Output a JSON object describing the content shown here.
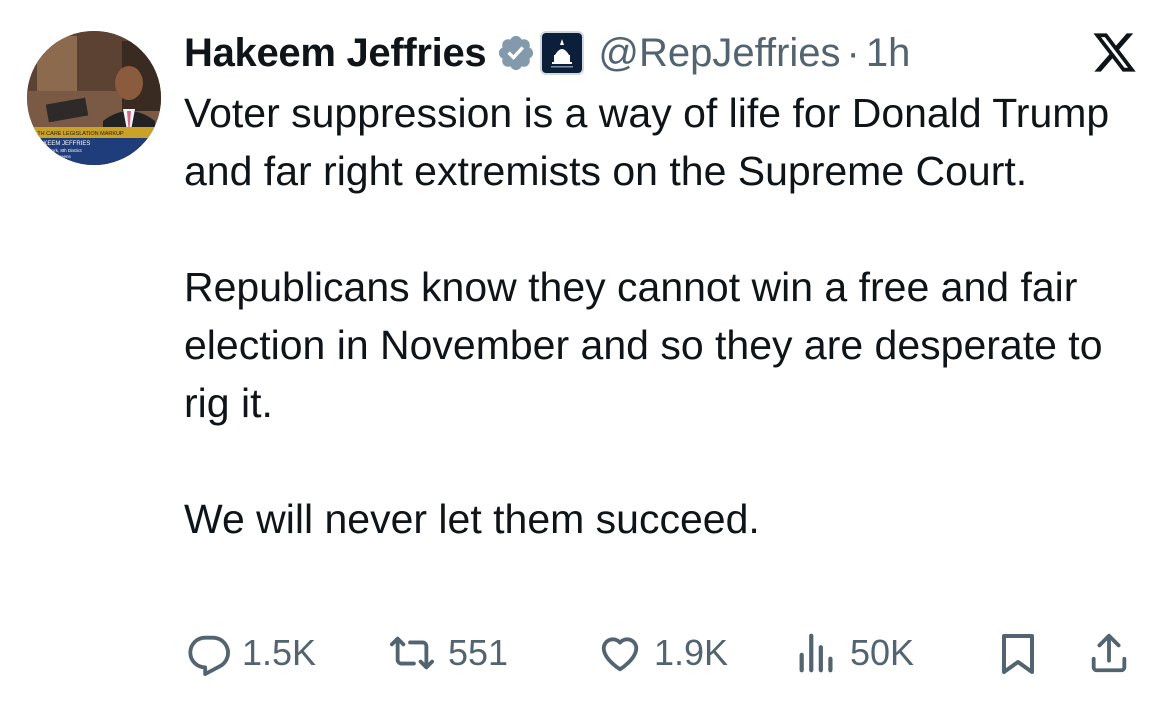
{
  "tweet": {
    "author_name": "Hakeem Jeffries",
    "handle": "@RepJeffries",
    "separator": "·",
    "time": "1h",
    "paragraphs": [
      "Voter suppression is a way of life for Donald Trump and far right extremists on the Supreme Court.",
      "Republicans know they cannot win a free and fair election in November and so they are desperate to rig it.",
      "We will never let them succeed."
    ],
    "avatar_caption": {
      "line1": "ALTH CARE LEGISLATION MARKUP",
      "line2": "HAKEEM JEFFRIES",
      "line3": "York, 8th District",
      "line4": "Queens"
    }
  },
  "actions": {
    "replies": "1.5K",
    "reposts": "551",
    "likes": "1.9K",
    "views": "50K"
  },
  "colors": {
    "text": "#0f1419",
    "secondary": "#536471",
    "verified_badge": "#829aab"
  },
  "icons": [
    "verified-badge-icon",
    "affiliation-badge-icon",
    "x-logo-icon",
    "reply-icon",
    "repost-icon",
    "like-icon",
    "views-icon",
    "bookmark-icon",
    "share-icon"
  ]
}
